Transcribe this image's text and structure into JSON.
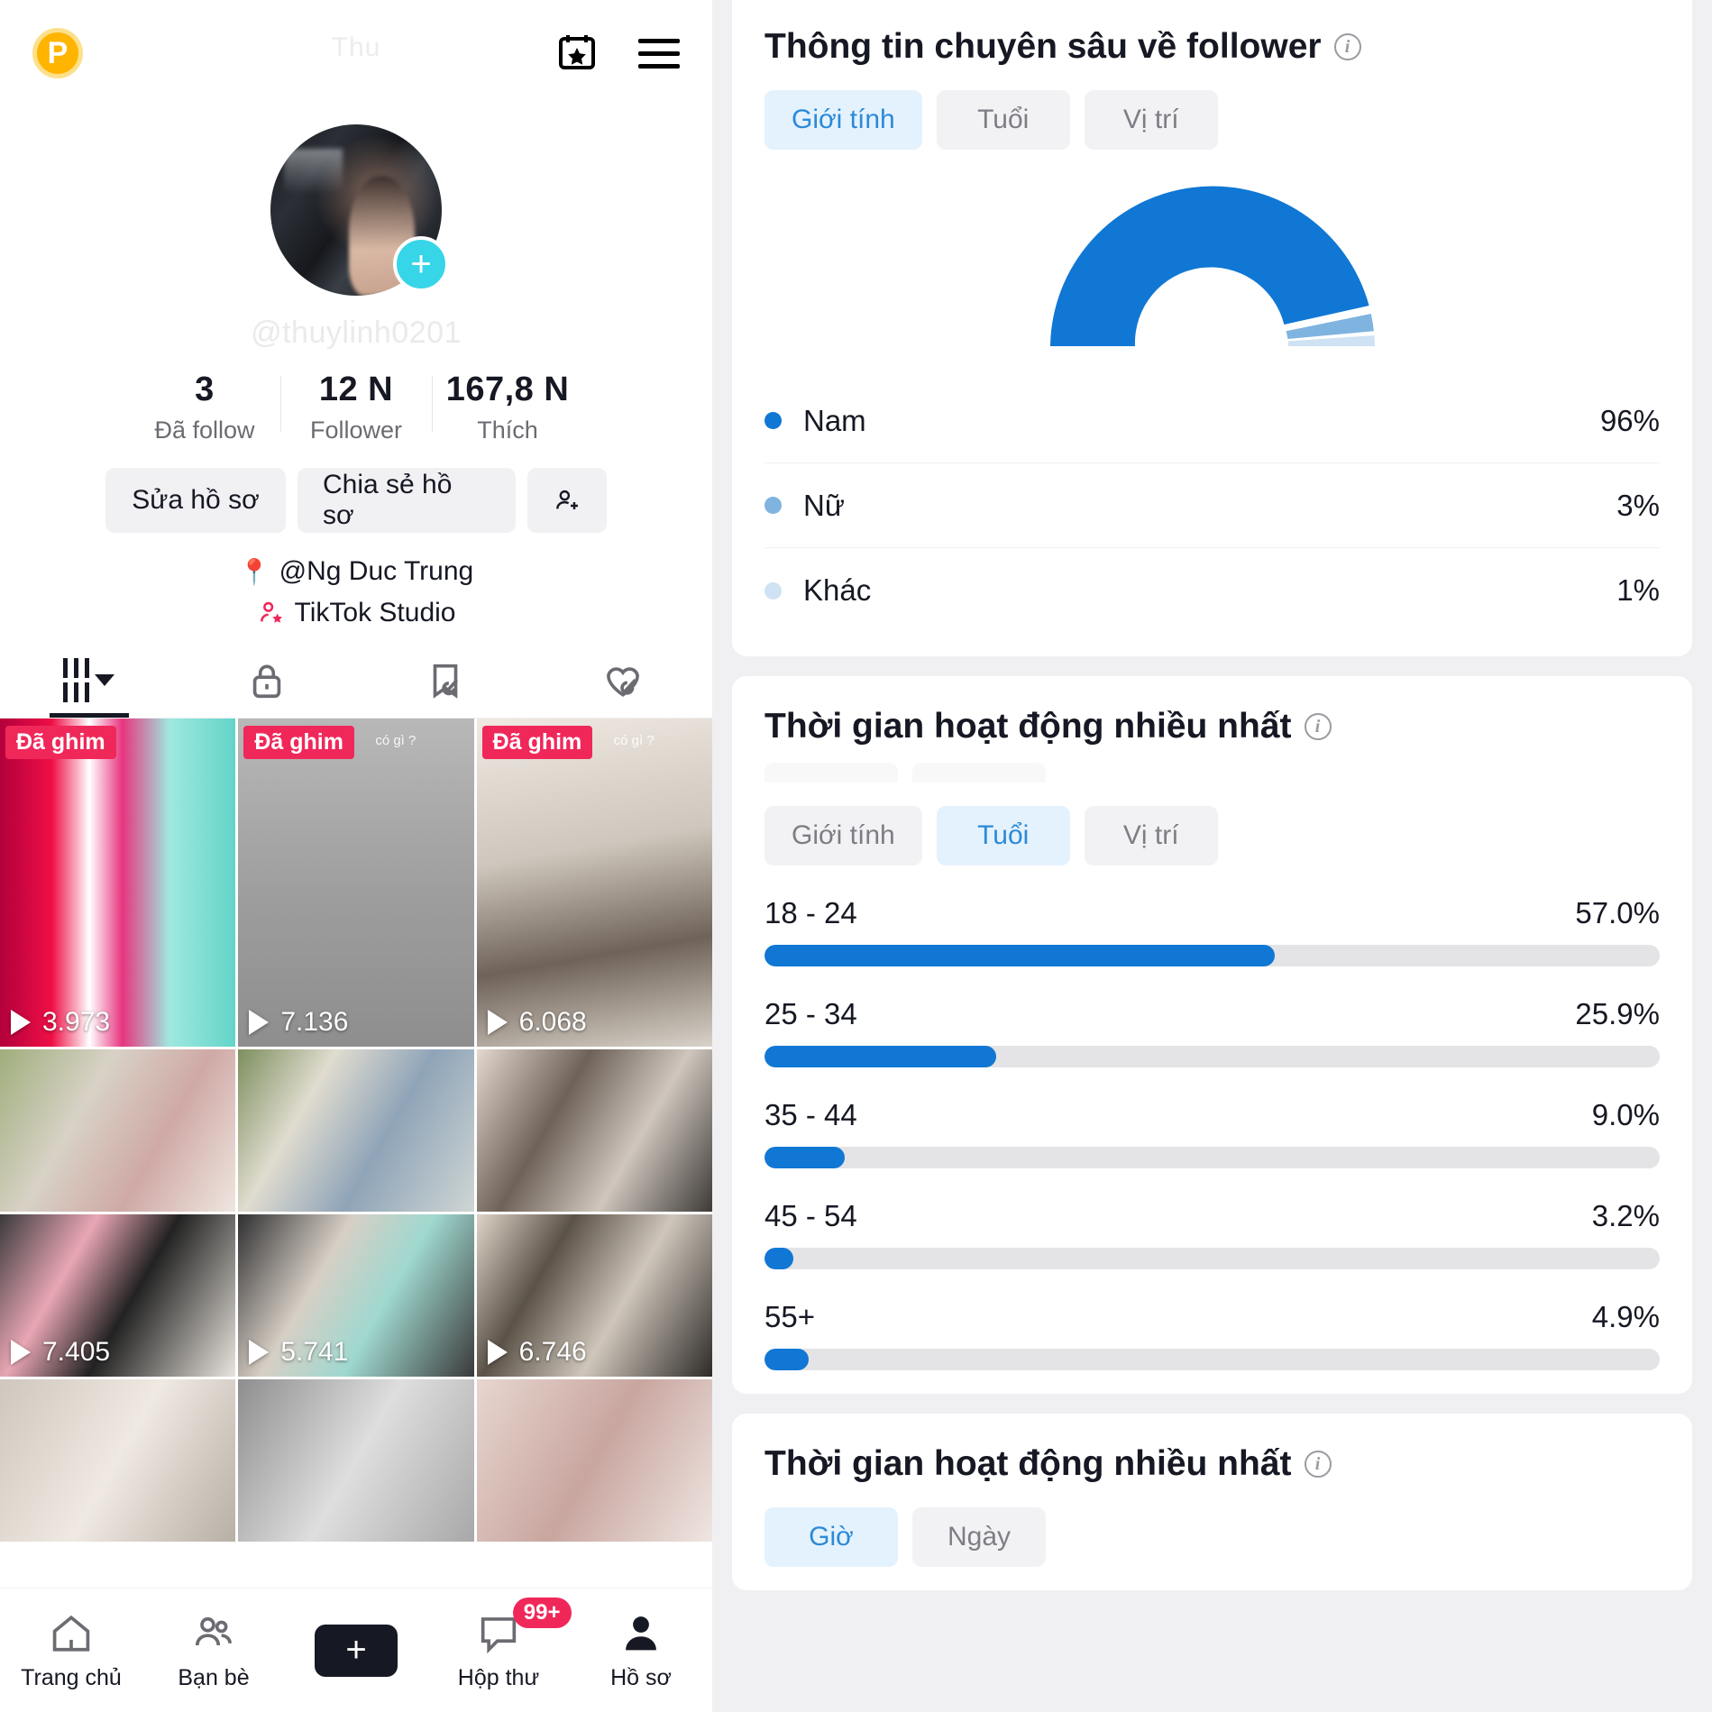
{
  "profile": {
    "topbar": {
      "badge_letter": "P",
      "ghost_title": "Thu",
      "calendar_icon": "calendar-star-icon",
      "menu_icon": "hamburger-icon"
    },
    "handle": "@thuylinh0201",
    "avatar_plus_label": "+",
    "stats": [
      {
        "num": "3",
        "label": "Đã follow"
      },
      {
        "num": "12 N",
        "label": "Follower"
      },
      {
        "num": "167,8 N",
        "label": "Thích"
      }
    ],
    "actions": {
      "edit": "Sửa hồ sơ",
      "share": "Chia sẻ hồ sơ",
      "add_user_icon": "add-user-icon"
    },
    "bio": [
      {
        "icon": "pin-icon",
        "glyph": "📍",
        "text": "@Ng Duc Trung"
      },
      {
        "icon": "studio-person-star-icon",
        "text": "TikTok Studio"
      }
    ],
    "tabs": [
      {
        "name": "posts",
        "icon": "grid-bars-icon",
        "active": true
      },
      {
        "name": "private",
        "icon": "lock-icon",
        "active": false
      },
      {
        "name": "saved",
        "icon": "bookmark-slash-icon",
        "active": false
      },
      {
        "name": "liked",
        "icon": "heart-slash-icon",
        "active": false
      }
    ],
    "pin_badge": "Đã ghim",
    "caption_overlay": "có gì ?",
    "videos": [
      {
        "views": "3.973",
        "pinned": true,
        "caption": ""
      },
      {
        "views": "7.136",
        "pinned": true,
        "caption": "có gì ?"
      },
      {
        "views": "6.068",
        "pinned": true,
        "caption": "có gì ?"
      },
      {
        "views": "",
        "pinned": false,
        "caption": ""
      },
      {
        "views": "",
        "pinned": false,
        "caption": ""
      },
      {
        "views": "",
        "pinned": false,
        "caption": ""
      },
      {
        "views": "7.405",
        "pinned": false,
        "caption": ""
      },
      {
        "views": "5.741",
        "pinned": false,
        "caption": ""
      },
      {
        "views": "6.746",
        "pinned": false,
        "caption": ""
      }
    ],
    "bottom_nav": [
      {
        "label": "Trang chủ",
        "icon": "home-icon",
        "badge": ""
      },
      {
        "label": "Bạn bè",
        "icon": "friends-icon",
        "badge": ""
      },
      {
        "label": "",
        "icon": "create-plus-icon",
        "badge": ""
      },
      {
        "label": "Hộp thư",
        "icon": "inbox-icon",
        "badge": "99+"
      },
      {
        "label": "Hồ sơ",
        "icon": "profile-person-icon",
        "badge": ""
      }
    ]
  },
  "analytics": {
    "follower_card": {
      "title": "Thông tin chuyên sâu về follower",
      "info_icon": "info-icon",
      "tabs": [
        {
          "label": "Giới tính",
          "selected": true
        },
        {
          "label": "Tuổi",
          "selected": false
        },
        {
          "label": "Vị trí",
          "selected": false
        }
      ]
    },
    "age_card": {
      "title": "Thời gian hoạt động nhiều nhất",
      "info_icon": "info-icon",
      "tabs": [
        {
          "label": "Giới tính",
          "selected": false
        },
        {
          "label": "Tuổi",
          "selected": true
        },
        {
          "label": "Vị trí",
          "selected": false
        }
      ]
    },
    "time_card": {
      "title": "Thời gian hoạt động nhiều nhất",
      "info_icon": "info-icon",
      "tabs": [
        {
          "label": "Giờ",
          "selected": true
        },
        {
          "label": "Ngày",
          "selected": false
        }
      ]
    }
  },
  "colors": {
    "accent_blue": "#1077d4",
    "light_blue": "#7fb3e0",
    "pale_blue": "#cfe2f3",
    "track_gray": "#e4e4e6",
    "tiktok_red": "#f0285a",
    "tiktok_cyan": "#2ee0e8",
    "chip_selected_bg": "#e4f2fd",
    "chip_selected_text": "#2b8ad9"
  },
  "chart_data": [
    {
      "type": "pie",
      "title": "Giới tính",
      "subtitle": "Thông tin chuyên sâu về follower",
      "render": "semicircle-gauge",
      "legend_position": "below",
      "labels": [
        "Nam",
        "Nữ",
        "Khác"
      ],
      "values": [
        96,
        3,
        1
      ],
      "value_labels": [
        "96%",
        "3%",
        "1%"
      ],
      "colors": [
        "#1077d4",
        "#7fb3e0",
        "#cfe2f3"
      ],
      "unit": "%"
    },
    {
      "type": "bar",
      "title": "Thời gian hoạt động nhiều nhất",
      "subtitle": "Tuổi",
      "orientation": "horizontal",
      "categories": [
        "18 - 24",
        "25 - 34",
        "35 - 44",
        "45 - 54",
        "55+"
      ],
      "values": [
        57.0,
        25.9,
        9.0,
        3.2,
        4.9
      ],
      "value_labels": [
        "57.0%",
        "25.9%",
        "9.0%",
        "3.2%",
        "4.9%"
      ],
      "xlabel": "",
      "ylabel": "",
      "xlim": [
        0,
        100
      ],
      "grid": false,
      "bar_color": "#1077d4",
      "track_color": "#e4e4e6",
      "unit": "%"
    }
  ]
}
